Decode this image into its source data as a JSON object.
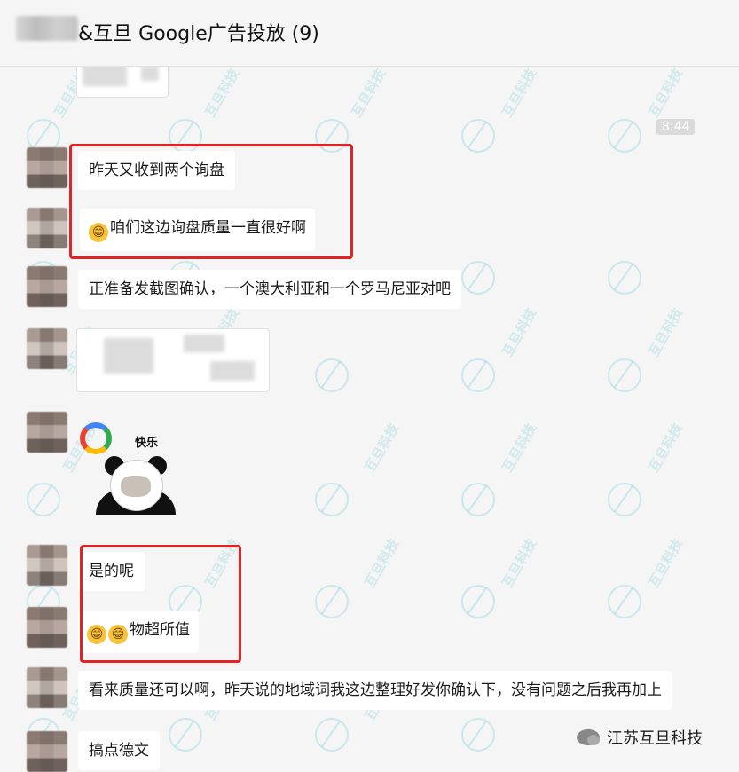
{
  "header": {
    "title": "&互旦 Google广告投放 (9)"
  },
  "time_badge": "8:44",
  "messages": [
    {
      "text": "昨天又收到两个询盘"
    },
    {
      "emoji": "😁",
      "text": "咱们这边询盘质量一直很好啊"
    },
    {
      "text": "正准备发截图确认，一个澳大利亚和一个罗马尼亚对吧"
    },
    {
      "sticker_text": "快乐"
    },
    {
      "text": "是的呢"
    },
    {
      "emoji1": "😁",
      "emoji2": "😁",
      "text": "物超所值"
    },
    {
      "text": "看来质量还可以啊，昨天说的地域词我这边整理好发你确认下，没有问题之后我再加上"
    },
    {
      "text": "搞点德文"
    }
  ],
  "watermark": {
    "text": "互旦科技"
  },
  "brand": {
    "text": "江苏互旦科技"
  },
  "colors": {
    "highlight": "#e02424",
    "background": "#f5f5f5",
    "bubble": "#ffffff"
  }
}
